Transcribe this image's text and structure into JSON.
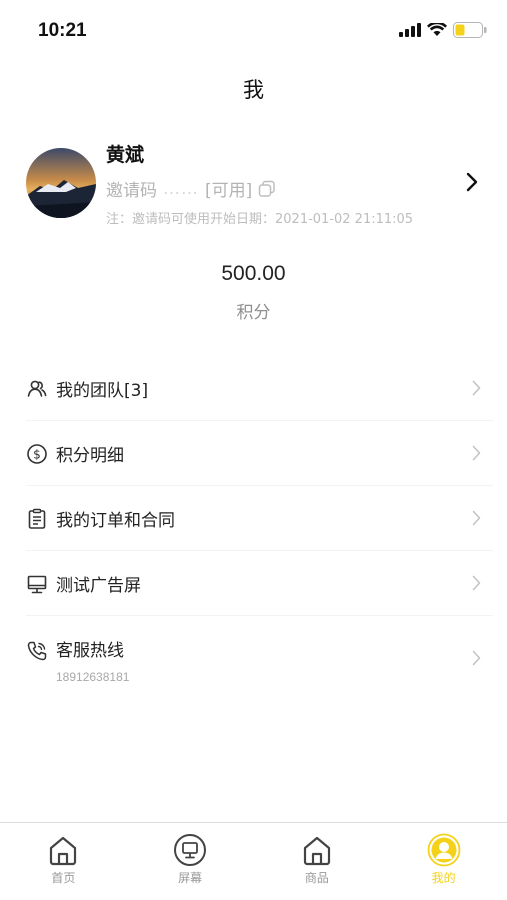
{
  "status": {
    "time": "10:21"
  },
  "header": {
    "title": "我"
  },
  "profile": {
    "name": "黄斌",
    "invite_prefix": "邀请码",
    "invite_code": "……",
    "invite_status": "[可用]",
    "note": "注：邀请码可使用开始日期：2021-01-02 21:11:05"
  },
  "points": {
    "value": "500.00",
    "label": "积分"
  },
  "menu": [
    {
      "label": "我的团队[3]",
      "icon": "team-icon"
    },
    {
      "label": "积分明细",
      "icon": "coin-icon"
    },
    {
      "label": "我的订单和合同",
      "icon": "document-icon"
    },
    {
      "label": "测试广告屏",
      "icon": "monitor-icon"
    },
    {
      "label": "客服热线",
      "sub": "18912638181",
      "icon": "phone-icon"
    }
  ],
  "tabbar": [
    {
      "label": "首页",
      "icon": "home-icon",
      "active": false
    },
    {
      "label": "屏幕",
      "icon": "screen-icon",
      "active": false
    },
    {
      "label": "商品",
      "icon": "shop-icon",
      "active": false
    },
    {
      "label": "我的",
      "icon": "profile-icon",
      "active": true
    }
  ],
  "colors": {
    "accent": "#f5d21a",
    "text": "#222222",
    "muted": "#999999"
  }
}
